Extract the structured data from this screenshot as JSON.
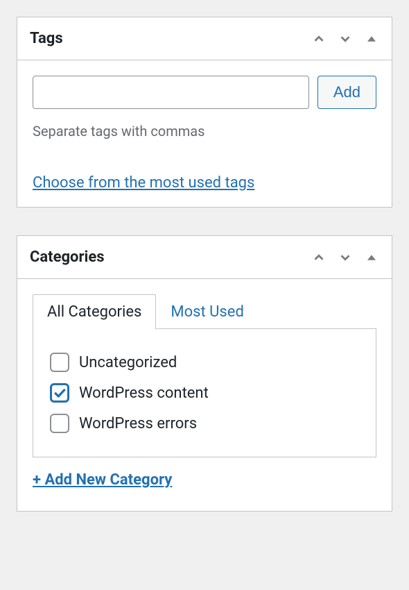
{
  "tags": {
    "title": "Tags",
    "input_value": "",
    "add_button": "Add",
    "help_text": "Separate tags with commas",
    "choose_link": "Choose from the most used tags"
  },
  "categories": {
    "title": "Categories",
    "tabs": {
      "all": "All Categories",
      "most_used": "Most Used"
    },
    "items": [
      {
        "label": "Uncategorized",
        "checked": false
      },
      {
        "label": "WordPress content",
        "checked": true
      },
      {
        "label": "WordPress errors",
        "checked": false
      }
    ],
    "add_new": "+ Add New Category"
  }
}
